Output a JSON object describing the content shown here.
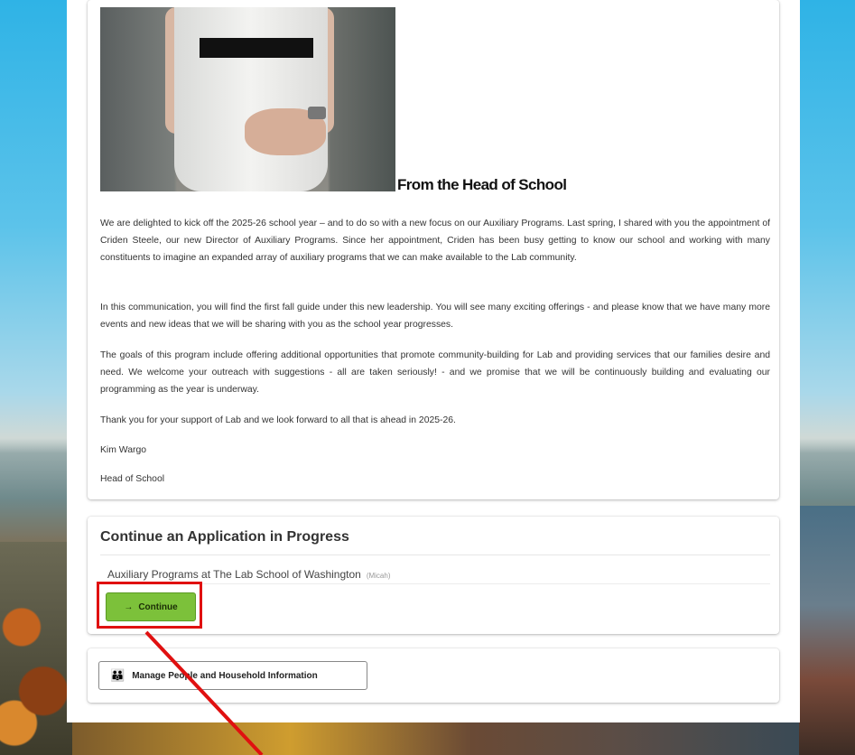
{
  "letter": {
    "title": "From the Head of School",
    "paragraphs": [
      "We are delighted to kick off the 2025-26 school year – and to do so with a new focus on our Auxiliary Programs. Last spring, I shared with you the appointment of Criden Steele, our new Director of Auxiliary Programs. Since her appointment, Criden has been busy getting to know our school and working with many constituents to imagine an expanded array of auxiliary programs that we can make available to the Lab community.",
      "In this communication, you will find the first fall guide under this new leadership. You will see many exciting offerings - and please know that we have many more events and new ideas that we will be sharing with you as the school year progresses.",
      "The goals of this program include offering additional opportunities that promote community-building for Lab and providing services that our families desire and need. We welcome your outreach with suggestions - all are taken seriously! - and we promise that we will be continuously building and evaluating our programming as the year is underway.",
      "Thank you for your support of Lab and we look forward to all that is ahead in 2025-26."
    ],
    "signature_name": "Kim Wargo",
    "signature_title": "Head of School"
  },
  "application": {
    "heading": "Continue an Application in Progress",
    "item_label": "Auxiliary Programs at The Lab School of Washington",
    "item_note": "(Micah)",
    "continue_label": "Continue",
    "continue_icon": "→"
  },
  "manage": {
    "label": "Manage People and Household Information",
    "icon": "👪"
  },
  "colors": {
    "continue_green": "#7cc13a",
    "highlight_red": "#e01010"
  }
}
